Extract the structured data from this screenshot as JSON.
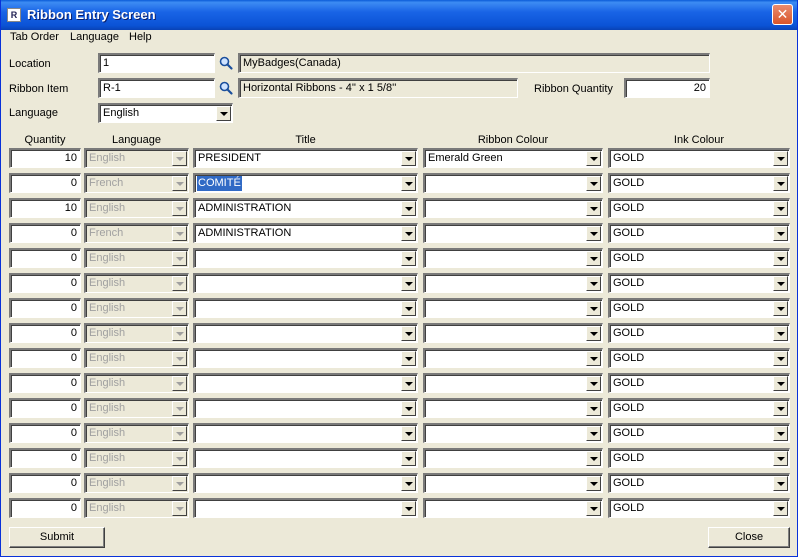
{
  "window": {
    "title": "Ribbon Entry Screen",
    "icon": "app-icon",
    "close_label": "✕"
  },
  "menu": [
    "Tab Order",
    "Language",
    "Help"
  ],
  "form": {
    "location": {
      "label": "Location",
      "value": "1",
      "description": "MyBadges(Canada)"
    },
    "ribbon_item": {
      "label": "Ribbon Item",
      "value": "R-1",
      "description": "Horizontal Ribbons - 4'' x 1 5/8''"
    },
    "ribbon_quantity": {
      "label": "Ribbon Quantity",
      "value": "20"
    },
    "language": {
      "label": "Language",
      "value": "English"
    }
  },
  "grid": {
    "headers": [
      "Quantity",
      "Language",
      "Title",
      "Ribbon Colour",
      "Ink Colour"
    ],
    "rows": [
      {
        "quantity": "10",
        "language": "English",
        "title": "PRESIDENT",
        "ribbon_colour": "Emerald Green",
        "ink_colour": "GOLD"
      },
      {
        "quantity": "0",
        "language": "French",
        "title": "COMITÉ",
        "ribbon_colour": "",
        "ink_colour": "GOLD",
        "title_selected": true
      },
      {
        "quantity": "10",
        "language": "English",
        "title": "ADMINISTRATION",
        "ribbon_colour": "",
        "ink_colour": "GOLD"
      },
      {
        "quantity": "0",
        "language": "French",
        "title": "ADMINISTRATION",
        "ribbon_colour": "",
        "ink_colour": "GOLD"
      },
      {
        "quantity": "0",
        "language": "English",
        "title": "",
        "ribbon_colour": "",
        "ink_colour": "GOLD"
      },
      {
        "quantity": "0",
        "language": "English",
        "title": "",
        "ribbon_colour": "",
        "ink_colour": "GOLD"
      },
      {
        "quantity": "0",
        "language": "English",
        "title": "",
        "ribbon_colour": "",
        "ink_colour": "GOLD"
      },
      {
        "quantity": "0",
        "language": "English",
        "title": "",
        "ribbon_colour": "",
        "ink_colour": "GOLD"
      },
      {
        "quantity": "0",
        "language": "English",
        "title": "",
        "ribbon_colour": "",
        "ink_colour": "GOLD"
      },
      {
        "quantity": "0",
        "language": "English",
        "title": "",
        "ribbon_colour": "",
        "ink_colour": "GOLD"
      },
      {
        "quantity": "0",
        "language": "English",
        "title": "",
        "ribbon_colour": "",
        "ink_colour": "GOLD"
      },
      {
        "quantity": "0",
        "language": "English",
        "title": "",
        "ribbon_colour": "",
        "ink_colour": "GOLD"
      },
      {
        "quantity": "0",
        "language": "English",
        "title": "",
        "ribbon_colour": "",
        "ink_colour": "GOLD"
      },
      {
        "quantity": "0",
        "language": "English",
        "title": "",
        "ribbon_colour": "",
        "ink_colour": "GOLD"
      },
      {
        "quantity": "0",
        "language": "English",
        "title": "",
        "ribbon_colour": "",
        "ink_colour": "GOLD"
      }
    ]
  },
  "buttons": {
    "submit": "Submit",
    "close": "Close"
  },
  "colors": {
    "titlebar": "#0b53d6",
    "face": "#ece9d8",
    "selection": "#316ac5",
    "disabled_text": "#a0a0a0"
  }
}
